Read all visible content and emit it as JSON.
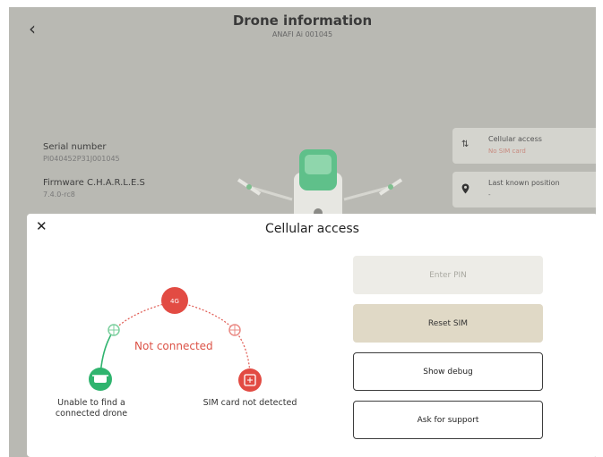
{
  "header": {
    "back_icon": "chevron-left-icon",
    "title": "Drone information",
    "subtitle": "ANAFI Ai 001045"
  },
  "info": {
    "serial_label": "Serial number",
    "serial_value": "PI040452P31J001045",
    "firmware_label": "Firmware C.H.A.R.L.E.S",
    "firmware_value": "7.4.0-rc8"
  },
  "cards": {
    "cellular_title": "Cellular access",
    "cellular_value": "No SIM card",
    "position_title": "Last known position",
    "position_value": "-"
  },
  "modal": {
    "close_icon": "close-icon",
    "title": "Cellular access",
    "status": "Not connected",
    "hub_label": "4G",
    "drone_label": "Unable to find a connected drone",
    "sim_label": "SIM card not detected",
    "buttons": {
      "enter_pin": "Enter PIN",
      "reset_sim": "Reset SIM",
      "show_debug": "Show debug",
      "ask_support": "Ask for support"
    }
  },
  "colors": {
    "accent_red": "#e24b43",
    "accent_green": "#2fb46e",
    "backdrop": "#b9b9b3"
  }
}
